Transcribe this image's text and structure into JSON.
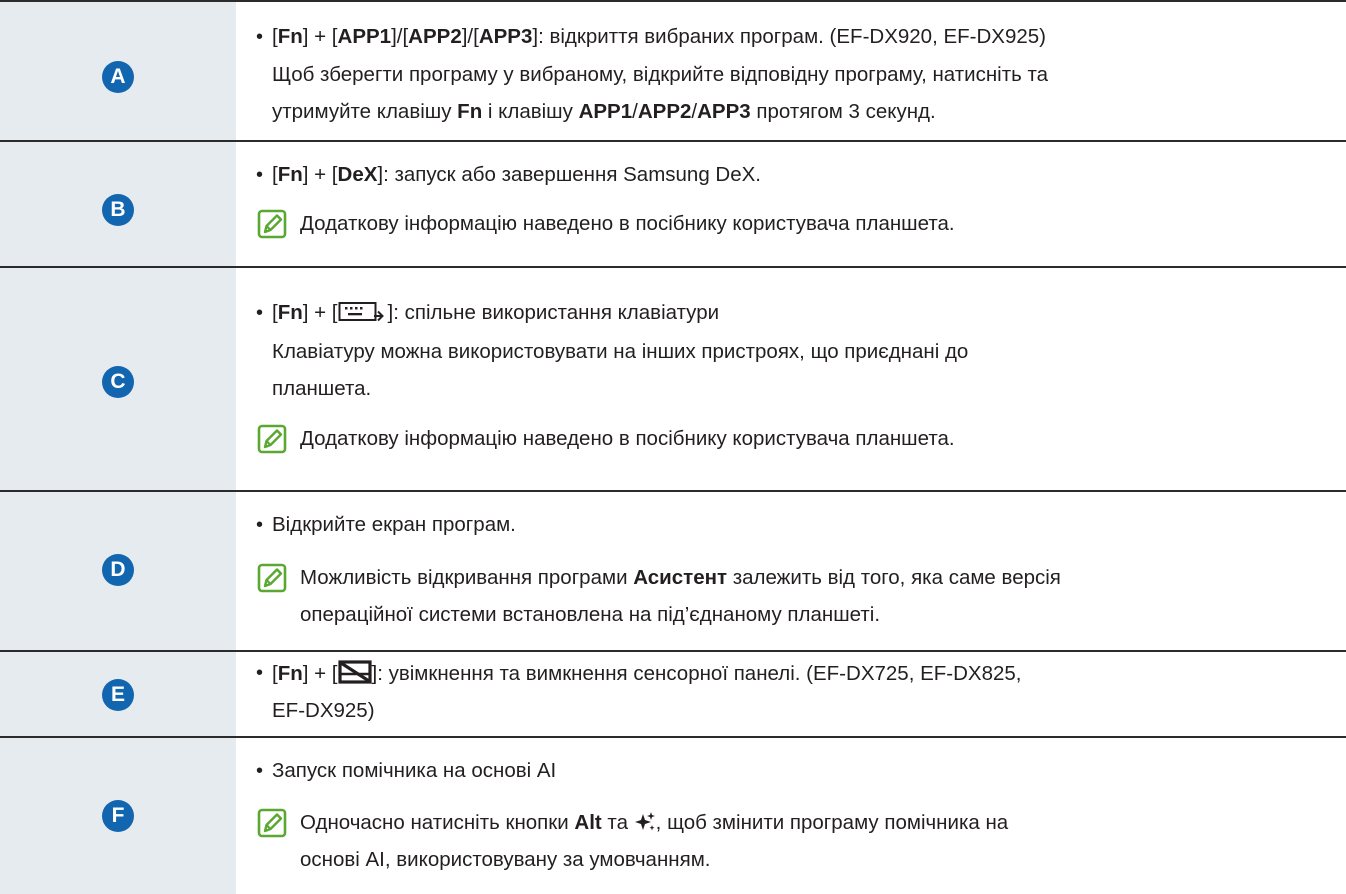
{
  "colors": {
    "badge": "#1266b0",
    "label_bg": "#e6ebef",
    "note_icon": "#5aa832",
    "rule": "#2b2b2b"
  },
  "rows": [
    {
      "badge": "A",
      "bullet": {
        "p1": "[",
        "fn": "Fn",
        "p2": "] + [",
        "app1": "APP1",
        "p3": "]/[",
        "app2": "APP2",
        "p4": "]/[",
        "app3": "APP3",
        "p5": "]: відкриття вибраних програм. (EF-DX920, EF-DX925)"
      },
      "desc1": "Щоб зберегти програму у вибраному, відкрийте відповідну програму, натисніть та",
      "desc2": {
        "p1": "утримуйте клавішу ",
        "fn": "Fn",
        "p2": " і клавішу ",
        "app1": "APP1",
        "s1": "/",
        "app2": "APP2",
        "s2": "/",
        "app3": "APP3",
        "p3": " протягом 3 секунд."
      }
    },
    {
      "badge": "B",
      "bullet": {
        "p1": "[",
        "fn": "Fn",
        "p2": "] + [",
        "dex": "DeX",
        "p3": "]: запуск або завершення Samsung DeX."
      },
      "note": "Додаткову інформацію наведено в посібнику користувача планшета."
    },
    {
      "badge": "C",
      "bullet": {
        "p1": "[",
        "fn": "Fn",
        "p2": "] + [",
        "p3": "]: спільне використання клавіатури"
      },
      "desc1": "Клавіатуру можна використовувати на інших пристроях, що приєднані до",
      "desc2": "планшета.",
      "note": "Додаткову інформацію наведено в посібнику користувача планшета."
    },
    {
      "badge": "D",
      "bullet": "Відкрийте екран програм.",
      "note1": {
        "p1": "Можливість відкривання програми ",
        "b": "Асистент",
        "p2": " залежить від того, яка саме версія"
      },
      "note2": "операційної системи встановлена на під’єднаному планшеті."
    },
    {
      "badge": "E",
      "bullet": {
        "p1": "[",
        "fn": "Fn",
        "p2": "] + [",
        "p3": "]: увімкнення та вимкнення сенсорної панелі. (EF-DX725, EF-DX825,"
      },
      "bullet2": "EF-DX925)"
    },
    {
      "badge": "F",
      "bullet": "Запуск помічника на основі AI",
      "note1": {
        "p1": "Одночасно натисніть кнопки ",
        "alt": "Alt",
        "p2": " та ",
        "p3": ", щоб змінити програму помічника на"
      },
      "note2": "основі AI, використовувану за умовчанням."
    }
  ]
}
